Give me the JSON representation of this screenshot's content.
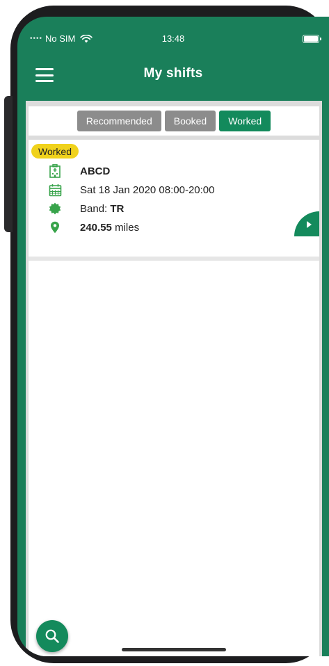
{
  "status_bar": {
    "carrier": "No SIM",
    "time": "13:48"
  },
  "header": {
    "title": "My shifts"
  },
  "tabs": [
    {
      "label": "Recommended",
      "active": false
    },
    {
      "label": "Booked",
      "active": false
    },
    {
      "label": "Worked",
      "active": true
    }
  ],
  "shift": {
    "status_badge": "Worked",
    "name": "ABCD",
    "datetime": "Sat 18 Jan 2020 08:00-20:00",
    "band_label": "Band:",
    "band_value": "TR",
    "distance_value": "240.55",
    "distance_unit": "miles"
  },
  "icons": {
    "menu": "hamburger-menu-icon",
    "hospital": "hospital-building-icon",
    "calendar": "calendar-icon",
    "band": "badge-seal-icon",
    "location": "location-pin-icon",
    "open": "play-arrow-icon",
    "search": "search-icon"
  },
  "colors": {
    "brand_green": "#1a7f5a",
    "active_tab": "#138a5c",
    "inactive_tab": "#8c8c8c",
    "badge_yellow": "#f0d21c",
    "icon_green": "#37a34a"
  }
}
